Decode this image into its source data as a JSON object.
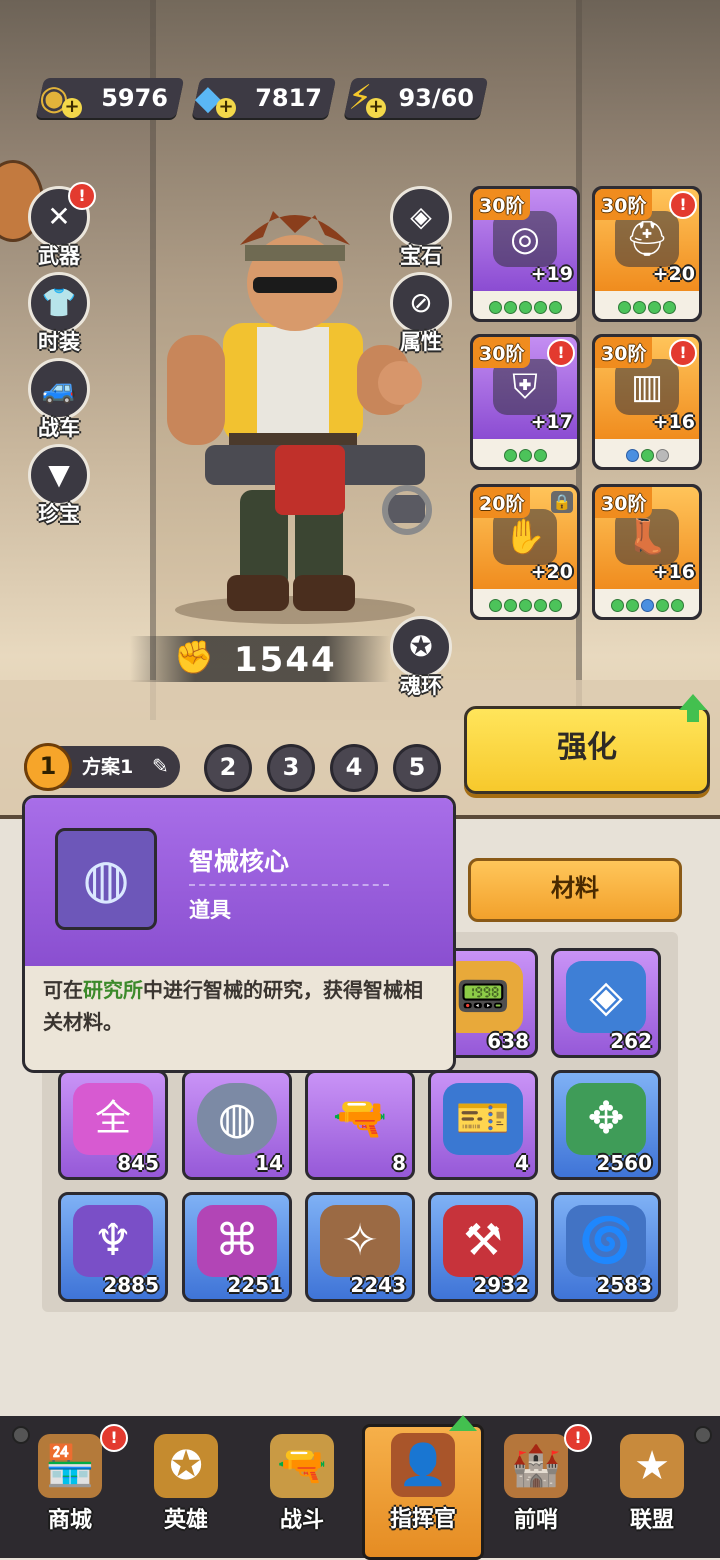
{
  "resources": {
    "gold": {
      "icon": "gold-coin-icon",
      "value": "5976"
    },
    "diamond": {
      "icon": "diamond-icon",
      "value": "7817"
    },
    "energy": {
      "icon": "lightning-icon",
      "value": "93/60"
    }
  },
  "left_menu": [
    {
      "id": "weapon",
      "label": "武器",
      "icon": "crossed-guns-icon",
      "alert": "!"
    },
    {
      "id": "outfit",
      "label": "时装",
      "icon": "shirt-icon"
    },
    {
      "id": "vehicle",
      "label": "战车",
      "icon": "car-icon"
    },
    {
      "id": "treasure",
      "label": "珍宝",
      "icon": "crest-icon"
    }
  ],
  "right_menu": [
    {
      "id": "gem",
      "label": "宝石",
      "icon": "gem-icon"
    },
    {
      "id": "attr",
      "label": "属性",
      "icon": "chip-icon"
    },
    {
      "id": "soul_ring",
      "label": "魂环",
      "icon": "ring-icon"
    }
  ],
  "power": {
    "icon": "power-fist-icon",
    "value": "1544"
  },
  "equipment": [
    {
      "tier": "30阶",
      "level": "+19",
      "rarity": "purple",
      "alert": false,
      "stars": [
        "green",
        "green",
        "green",
        "green",
        "green"
      ]
    },
    {
      "tier": "30阶",
      "level": "+20",
      "rarity": "orange",
      "alert": true,
      "stars": [
        "green",
        "green",
        "green",
        "green"
      ]
    },
    {
      "tier": "30阶",
      "level": "+17",
      "rarity": "purple",
      "alert": true,
      "stars": [
        "green",
        "green",
        "green"
      ]
    },
    {
      "tier": "30阶",
      "level": "+16",
      "rarity": "orange",
      "alert": true,
      "stars": [
        "blue",
        "green",
        "grey"
      ]
    },
    {
      "tier": "20阶",
      "level": "+20",
      "rarity": "orange",
      "alert": false,
      "locked": true,
      "stars": [
        "green",
        "green",
        "green",
        "green",
        "green"
      ]
    },
    {
      "tier": "30阶",
      "level": "+16",
      "rarity": "orange",
      "alert": false,
      "stars": [
        "green",
        "green",
        "blue",
        "green",
        "green"
      ]
    }
  ],
  "enhance_label": "强化",
  "plans": {
    "active_num": "1",
    "active_label": "方案1",
    "others": [
      "2",
      "3",
      "4",
      "5"
    ]
  },
  "tooltip": {
    "name": "智械核心",
    "type": "道具",
    "desc_pre": "可在",
    "desc_highlight": "研究所",
    "desc_post": "中进行智械的研究，获得智械相关材料。"
  },
  "materials_tab": "材料",
  "items": [
    {
      "icon": "walkie-talkie-icon",
      "count": "638",
      "rarity": "purple"
    },
    {
      "icon": "blueprint-chip-icon",
      "count": "262",
      "rarity": "purple"
    },
    {
      "icon": "purple-can-icon",
      "count": "845",
      "rarity": "purple",
      "glyph": "全"
    },
    {
      "icon": "mech-core-icon",
      "count": "14",
      "rarity": "purple"
    },
    {
      "icon": "flare-gun-icon",
      "count": "8",
      "rarity": "purple"
    },
    {
      "icon": "ticket-icon",
      "count": "4",
      "rarity": "purple"
    },
    {
      "icon": "green-can-icon",
      "count": "2560",
      "rarity": "blue"
    },
    {
      "icon": "violet-can-icon",
      "count": "2885",
      "rarity": "blue"
    },
    {
      "icon": "pink-can-icon",
      "count": "2251",
      "rarity": "blue"
    },
    {
      "icon": "brown-can-icon",
      "count": "2243",
      "rarity": "blue"
    },
    {
      "icon": "red-can-icon",
      "count": "2932",
      "rarity": "blue"
    },
    {
      "icon": "blue-can-icon",
      "count": "2583",
      "rarity": "blue"
    }
  ],
  "nav": [
    {
      "label": "商城",
      "icon": "shop-icon",
      "alert": "!"
    },
    {
      "label": "英雄",
      "icon": "hero-badge-icon"
    },
    {
      "label": "战斗",
      "icon": "battle-gun-icon"
    },
    {
      "label": "指挥官",
      "icon": "commander-icon",
      "active": true,
      "upgrade": true
    },
    {
      "label": "前哨",
      "icon": "outpost-icon",
      "alert": "!"
    },
    {
      "label": "联盟",
      "icon": "alliance-icon"
    }
  ],
  "colors": {
    "accent": "#f7c92c",
    "alert": "#e33a2f",
    "upgrade": "#43c04f",
    "purple": "#9659d8",
    "blue": "#3f74d7"
  }
}
